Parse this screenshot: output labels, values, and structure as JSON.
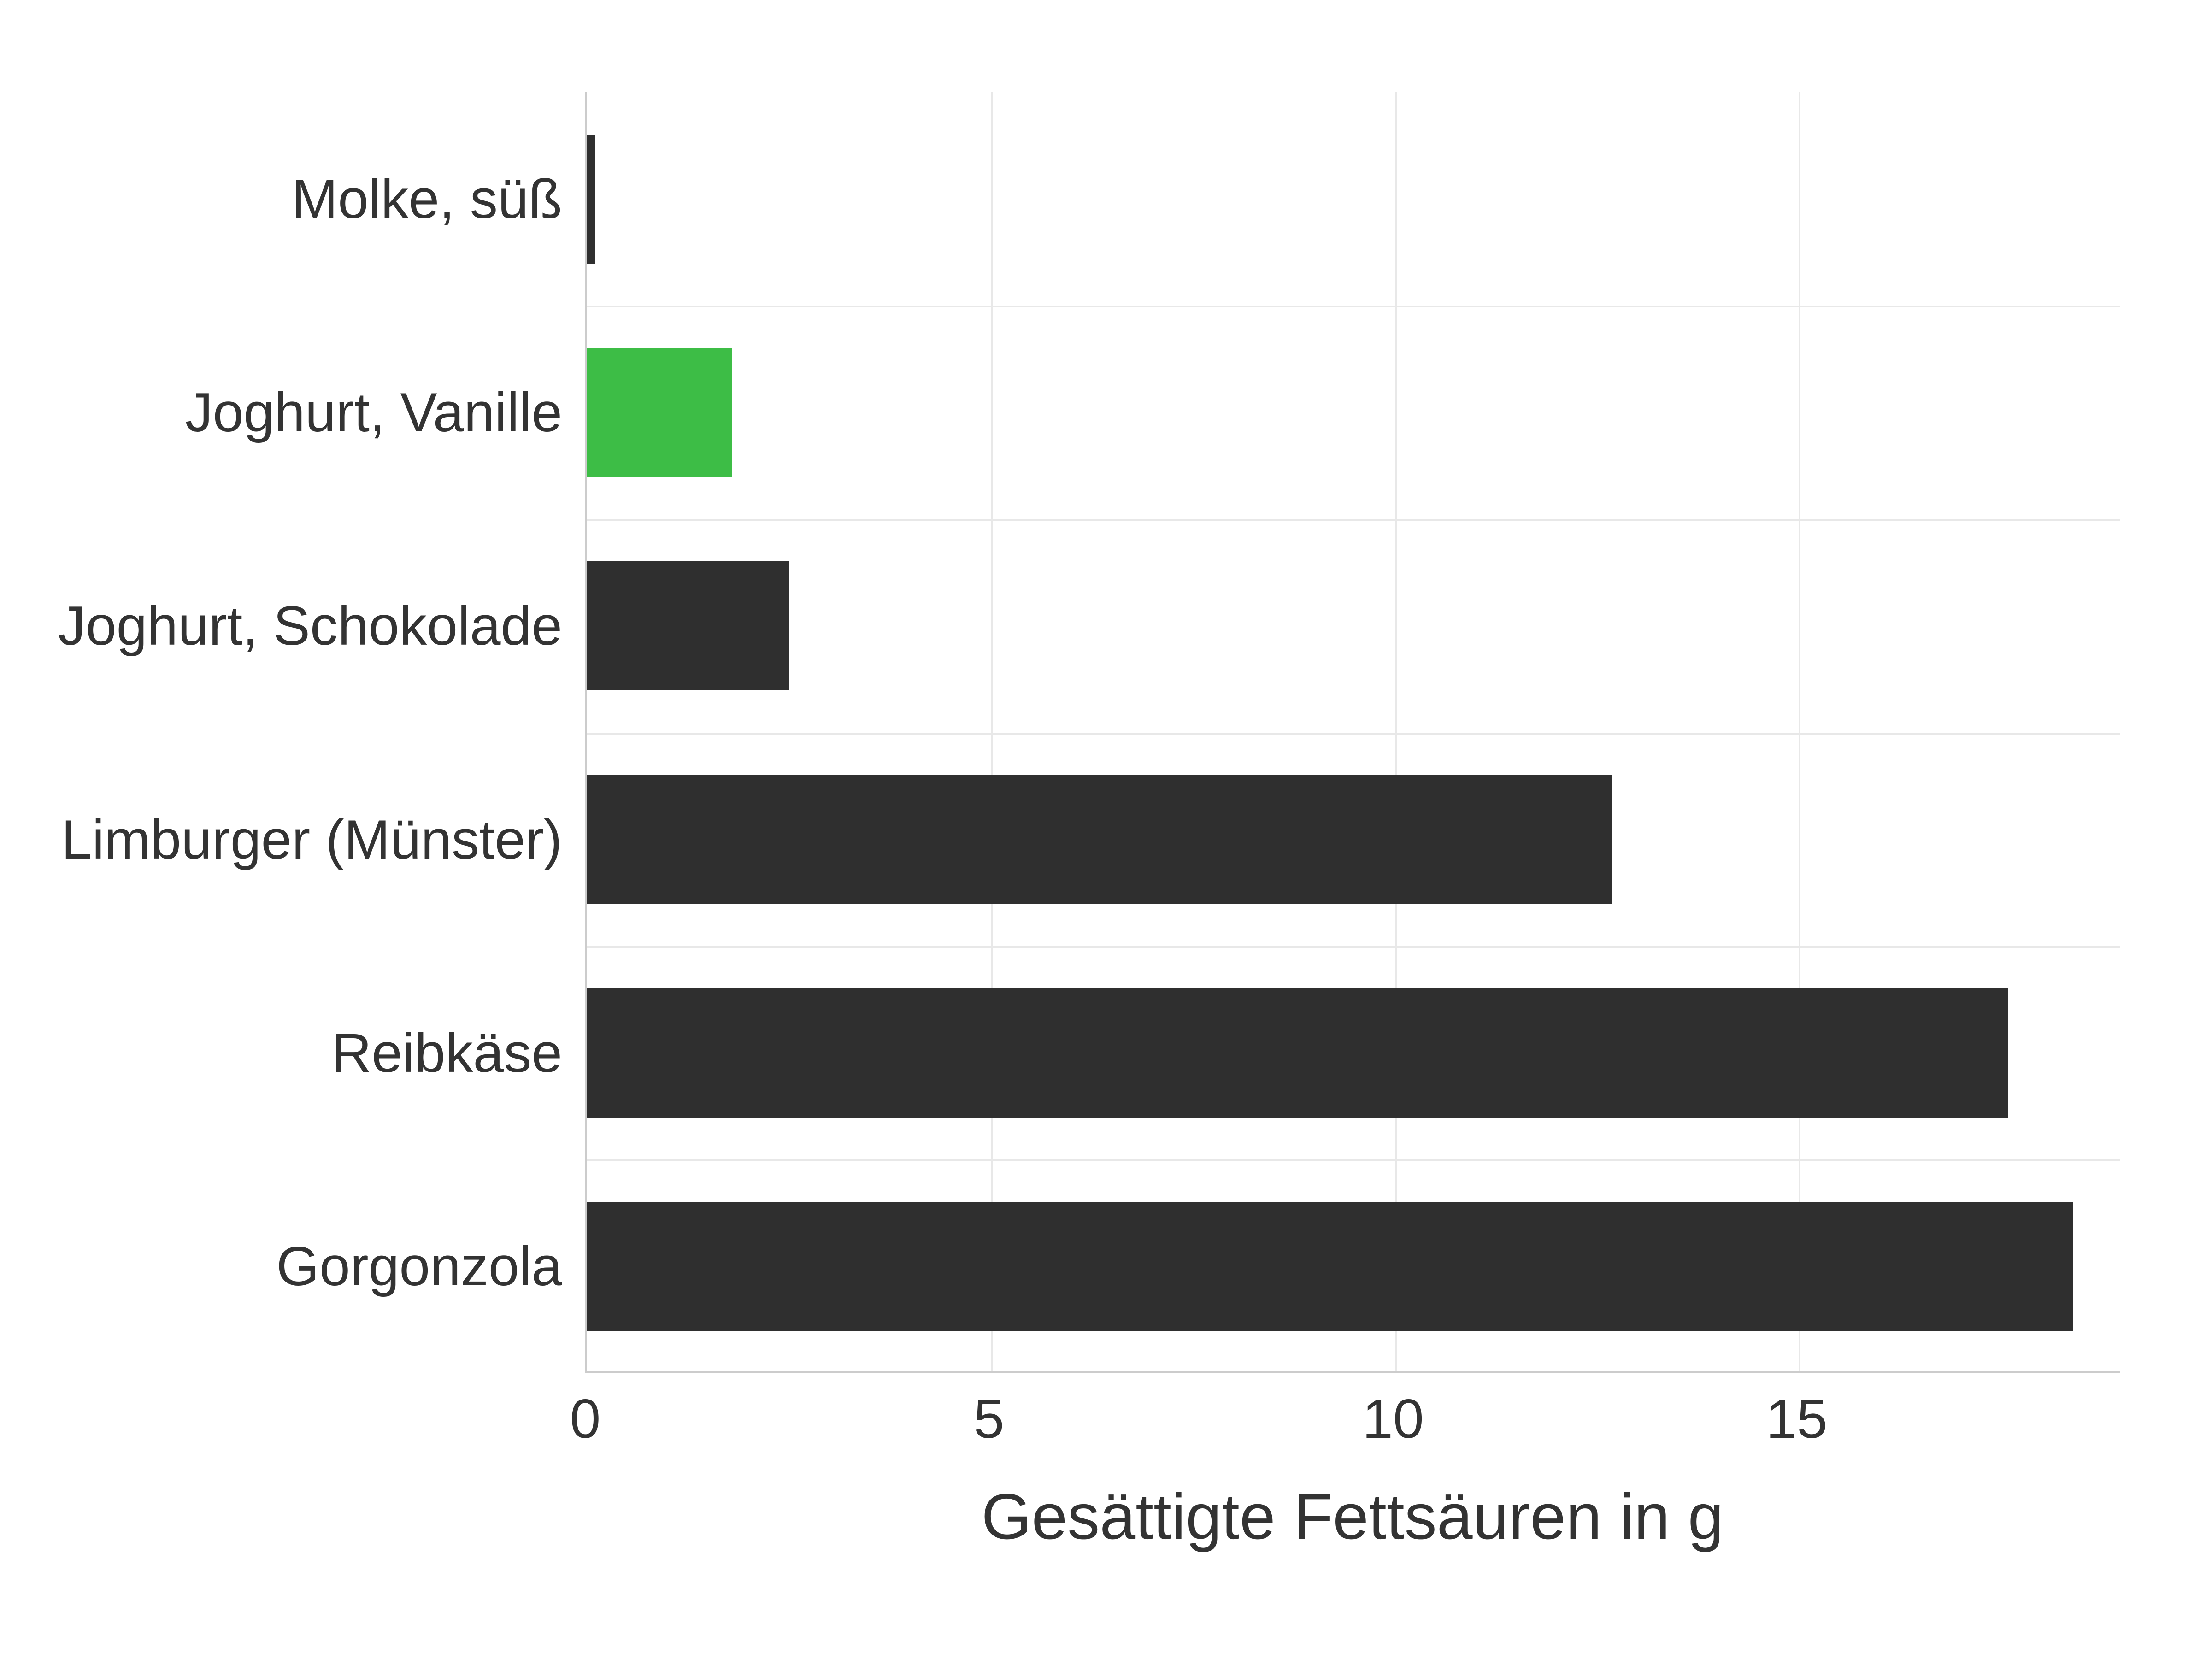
{
  "chart_data": {
    "type": "bar",
    "orientation": "horizontal",
    "categories": [
      "Molke, süß",
      "Joghurt, Vanille",
      "Joghurt, Schokolade",
      "Limburger (Münster)",
      "Reibkäse",
      "Gorgonzola"
    ],
    "values": [
      0.1,
      1.8,
      2.5,
      12.7,
      17.6,
      18.4
    ],
    "highlight_index": 1,
    "xlabel": "Gesättigte Fettsäuren in g",
    "ylabel": "",
    "xlim": [
      0,
      19
    ],
    "x_ticks": [
      0,
      5,
      10,
      15
    ],
    "colors": {
      "default": "#2f2f2f",
      "highlight": "#3dbd46"
    }
  }
}
